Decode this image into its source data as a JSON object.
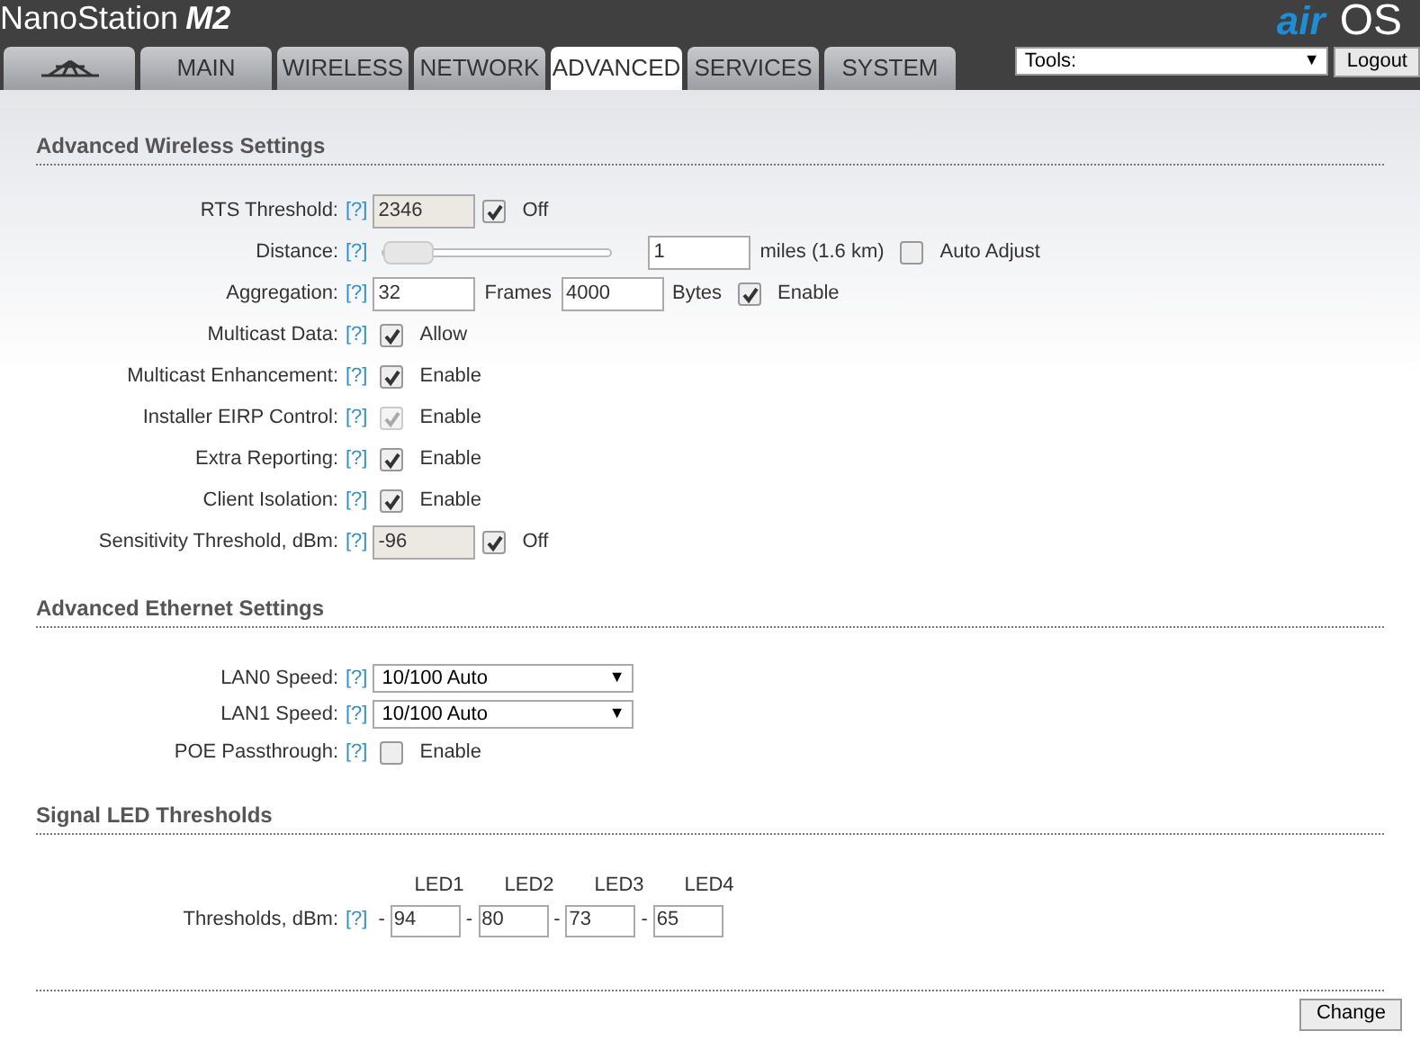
{
  "header": {
    "product": "NanoStation",
    "model": "M2",
    "brand_prefix": "air",
    "brand_suffix": "OS"
  },
  "tabs": [
    {
      "kind": "logo",
      "selected": false
    },
    {
      "label": "MAIN",
      "selected": false
    },
    {
      "label": "WIRELESS",
      "selected": false
    },
    {
      "label": "NETWORK",
      "selected": false
    },
    {
      "label": "ADVANCED",
      "selected": true
    },
    {
      "label": "SERVICES",
      "selected": false
    },
    {
      "label": "SYSTEM",
      "selected": false
    }
  ],
  "tools": {
    "value": "Tools:",
    "arrow": "▼"
  },
  "logout": "Logout",
  "sections": [
    {
      "title": "Advanced Wireless Settings",
      "rows": [
        {
          "label": "RTS Threshold:",
          "help": "[?]",
          "items": [
            {
              "kind": "input",
              "value": "2346",
              "disabled": true
            },
            {
              "kind": "check",
              "checked": true,
              "disabled": false,
              "label": "Off"
            }
          ]
        },
        {
          "label": "Distance:",
          "help": "[?]",
          "items": [
            {
              "kind": "slider",
              "level": 0.0
            },
            {
              "kind": "input",
              "value": "1",
              "disabled": false
            },
            {
              "kind": "text",
              "text": "miles (1.6 km)"
            },
            {
              "kind": "check",
              "checked": false,
              "disabled": false,
              "label": "Auto Adjust"
            }
          ]
        },
        {
          "label": "Aggregation:",
          "help": "[?]",
          "items": [
            {
              "kind": "input",
              "value": "32",
              "disabled": false
            },
            {
              "kind": "text",
              "text": "Frames"
            },
            {
              "kind": "input",
              "value": "4000",
              "disabled": false
            },
            {
              "kind": "text",
              "text": "Bytes"
            },
            {
              "kind": "check",
              "checked": true,
              "disabled": false,
              "label": "Enable"
            }
          ]
        },
        {
          "label": "Multicast Data:",
          "help": "[?]",
          "items": [
            {
              "kind": "check",
              "checked": true,
              "disabled": false,
              "label": "Allow"
            }
          ]
        },
        {
          "label": "Multicast Enhancement:",
          "help": "[?]",
          "items": [
            {
              "kind": "check",
              "checked": true,
              "disabled": false,
              "label": "Enable"
            }
          ]
        },
        {
          "label": "Installer EIRP Control:",
          "help": "[?]",
          "items": [
            {
              "kind": "check",
              "checked": true,
              "disabled": true,
              "label": "Enable"
            }
          ]
        },
        {
          "label": "Extra Reporting:",
          "help": "[?]",
          "items": [
            {
              "kind": "check",
              "checked": true,
              "disabled": false,
              "label": "Enable"
            }
          ]
        },
        {
          "label": "Client Isolation:",
          "help": "[?]",
          "items": [
            {
              "kind": "check",
              "checked": true,
              "disabled": false,
              "label": "Enable"
            }
          ]
        },
        {
          "label": "Sensitivity Threshold, dBm:",
          "help": "[?]",
          "items": [
            {
              "kind": "input",
              "value": "-96",
              "disabled": true
            },
            {
              "kind": "check",
              "checked": true,
              "disabled": false,
              "label": "Off"
            }
          ]
        }
      ]
    },
    {
      "title": "Advanced Ethernet Settings",
      "rows": [
        {
          "label": "LAN0 Speed:",
          "help": "[?]",
          "items": [
            {
              "kind": "select",
              "value": "10/100 Auto",
              "arrow": "▼"
            }
          ]
        },
        {
          "label": "LAN1 Speed:",
          "help": "[?]",
          "items": [
            {
              "kind": "select",
              "value": "10/100 Auto",
              "arrow": "▼"
            }
          ]
        },
        {
          "label": "POE Passthrough:",
          "help": "[?]",
          "items": [
            {
              "kind": "check",
              "checked": false,
              "disabled": false,
              "label": "Enable"
            }
          ]
        }
      ]
    },
    {
      "title": "Signal LED Thresholds",
      "leds": {
        "label": "Thresholds, dBm:",
        "help": "[?]",
        "columns": [
          {
            "heading": "LED1",
            "sign": "-",
            "value": "94"
          },
          {
            "heading": "LED2",
            "sign": "-",
            "value": "80"
          },
          {
            "heading": "LED3",
            "sign": "-",
            "value": "73"
          },
          {
            "heading": "LED4",
            "sign": "-",
            "value": "65"
          }
        ]
      }
    }
  ],
  "change_button": "Change"
}
